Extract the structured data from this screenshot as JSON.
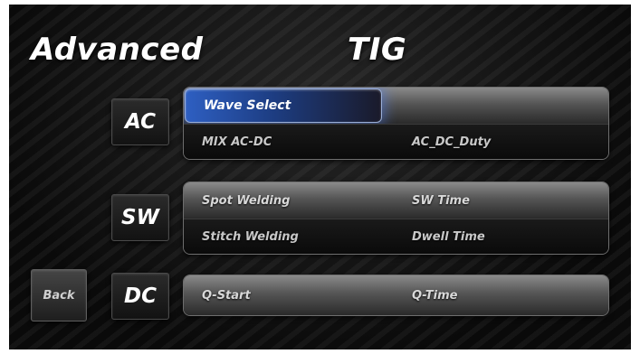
{
  "header": {
    "mode": "Advanced",
    "process": "TIG"
  },
  "groups": {
    "ac": {
      "label": "AC",
      "wave_select": "Wave Select",
      "rows": [
        {
          "left": "MIX AC-DC",
          "right": "AC_DC_Duty"
        }
      ]
    },
    "sw": {
      "label": "SW",
      "rows": [
        {
          "left": "Spot Welding",
          "right": "SW Time"
        },
        {
          "left": "Stitch Welding",
          "right": "Dwell Time"
        }
      ]
    },
    "dc": {
      "label": "DC",
      "rows": [
        {
          "left": "Q-Start",
          "right": "Q-Time"
        }
      ]
    }
  },
  "back_label": "Back",
  "colors": {
    "highlight": "#2e5fc2",
    "text": "#ffffff",
    "background": "#0c0c0c"
  }
}
